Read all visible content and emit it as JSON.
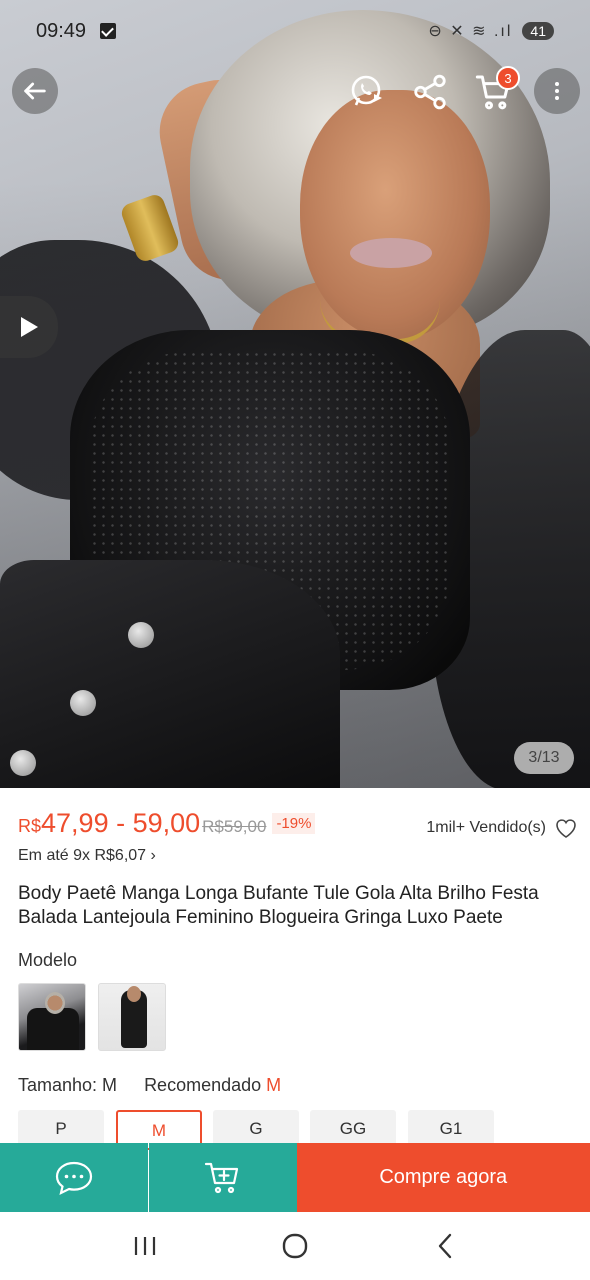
{
  "status_bar": {
    "time": "09:49",
    "network_icons": "⊖ ✕ ≋ .ıl",
    "battery": "41"
  },
  "gallery": {
    "image_counter": "3/13",
    "cart_badge": "3"
  },
  "product": {
    "price_currency": "R$",
    "price_range": "47,99 - 59,00",
    "original_price": "R$59,00",
    "discount": "-19%",
    "sold": "1mil+ Vendido(s)",
    "installments": "Em até 9x R$6,07 ›",
    "title": "Body Paetê Manga Longa Bufante Tule Gola Alta Brilho Festa Balada Lantejoula Feminino Blogueira Gringa Luxo Paete"
  },
  "variants": {
    "label": "Modelo"
  },
  "sizes": {
    "label": "Tamanho: M",
    "recommended_label": "Recomendado",
    "recommended_value": "M",
    "options": [
      "P",
      "M",
      "G",
      "GG",
      "G1"
    ],
    "selected": "M"
  },
  "bottom_bar": {
    "buy_now": "Compre agora"
  },
  "icons": {
    "back": "arrow-left-icon",
    "whatsapp": "whatsapp-share-icon",
    "share": "share-icon",
    "cart": "cart-icon",
    "more": "more-vertical-icon",
    "play": "play-icon",
    "heart": "heart-icon",
    "chat": "chat-icon",
    "add_to_cart": "add-to-cart-icon"
  },
  "colors": {
    "accent": "#ee4d2d",
    "secondary": "#26aa99"
  }
}
